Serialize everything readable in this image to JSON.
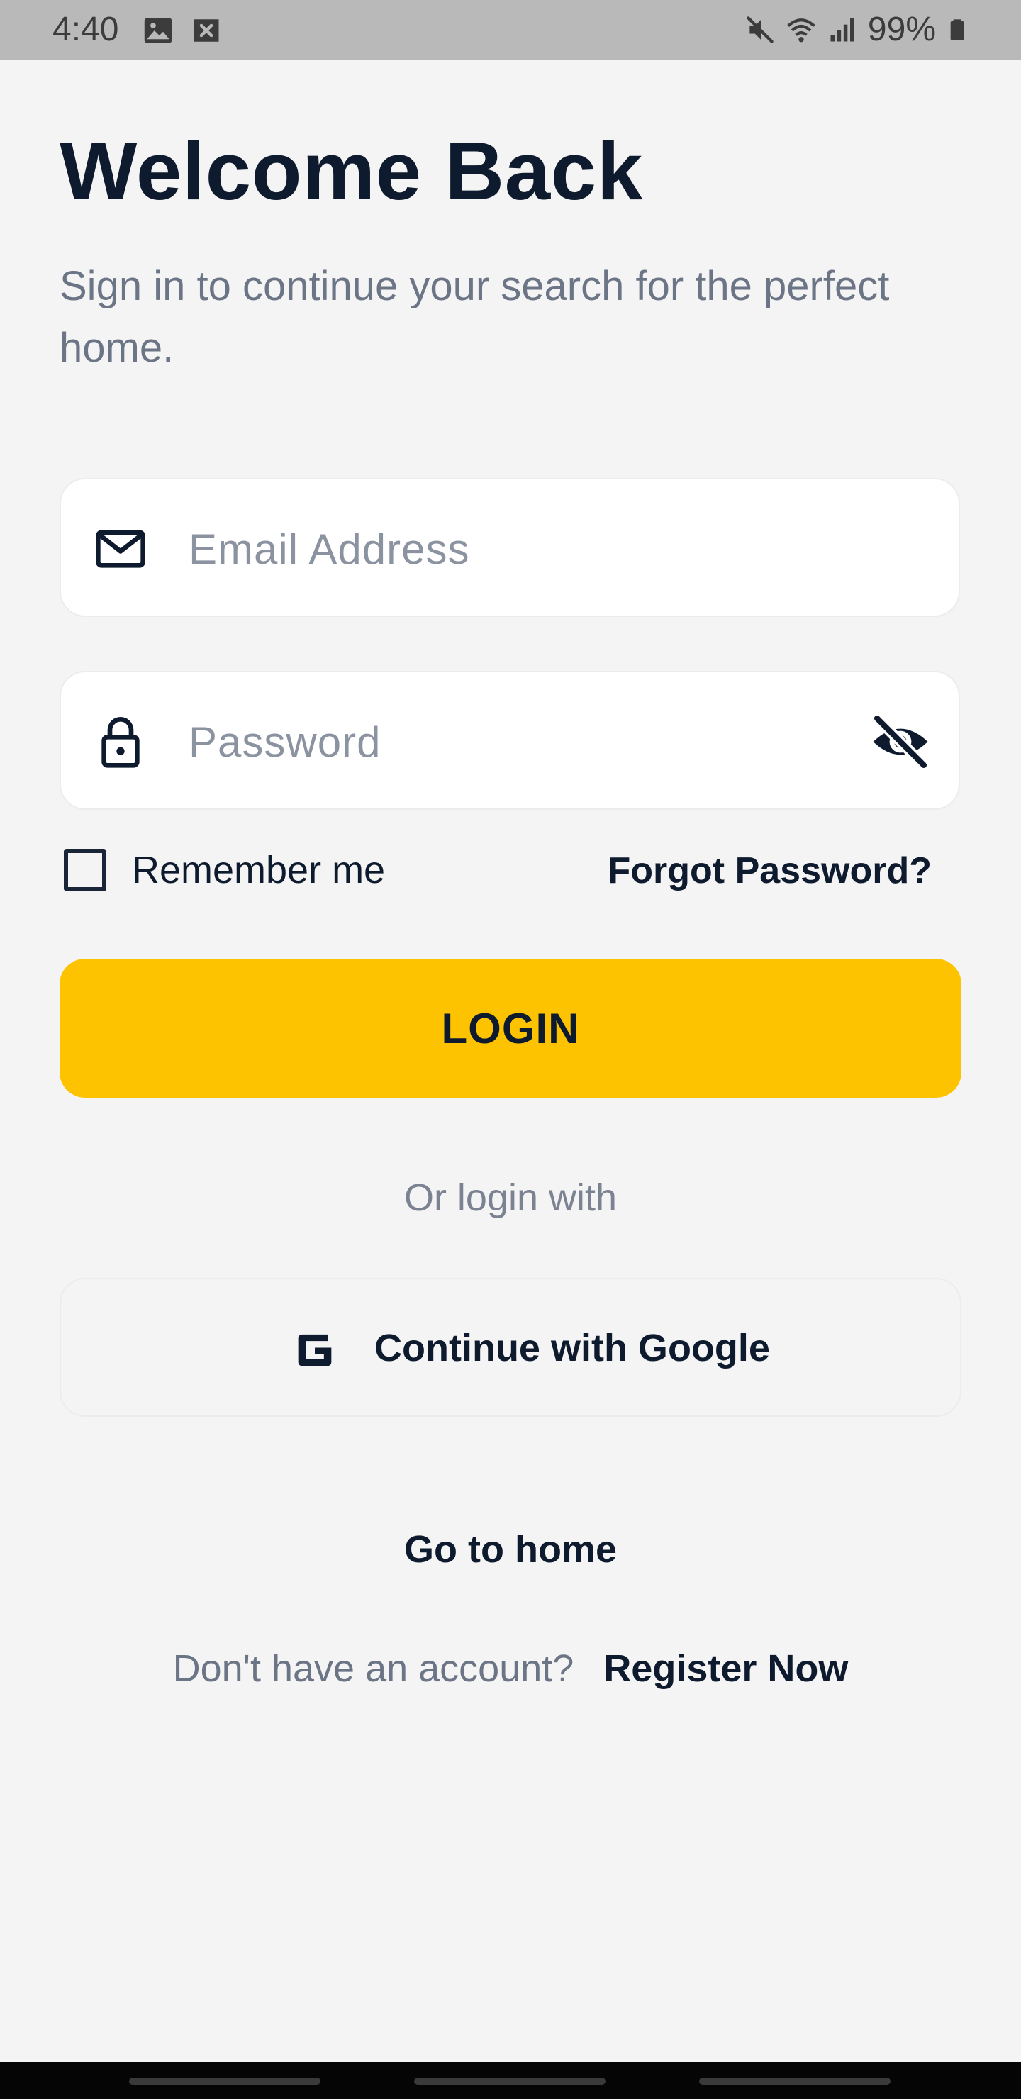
{
  "status_bar": {
    "time": "4:40",
    "battery": "99%",
    "left_icons": [
      "image-icon",
      "blocked-notification-icon"
    ],
    "right_icons": [
      "mute-icon",
      "wifi-icon",
      "signal-icon",
      "battery-icon"
    ]
  },
  "header": {
    "title": "Welcome Back",
    "subtitle": "Sign in to continue your search for the perfect home."
  },
  "form": {
    "email_placeholder": "Email Address",
    "email_value": "",
    "password_placeholder": "Password",
    "password_value": "",
    "remember_label": "Remember me",
    "remember_checked": false,
    "forgot_label": "Forgot Password?",
    "login_label": "LOGIN"
  },
  "social": {
    "or_text": "Or login with",
    "google_label": "Continue with Google"
  },
  "footer": {
    "go_home": "Go to home",
    "no_account": "Don't have an account?",
    "register": "Register Now"
  },
  "colors": {
    "accent": "#fdc300",
    "primary_text": "#0e1a2d",
    "secondary_text": "#6c7586",
    "background": "#f4f4f4"
  }
}
